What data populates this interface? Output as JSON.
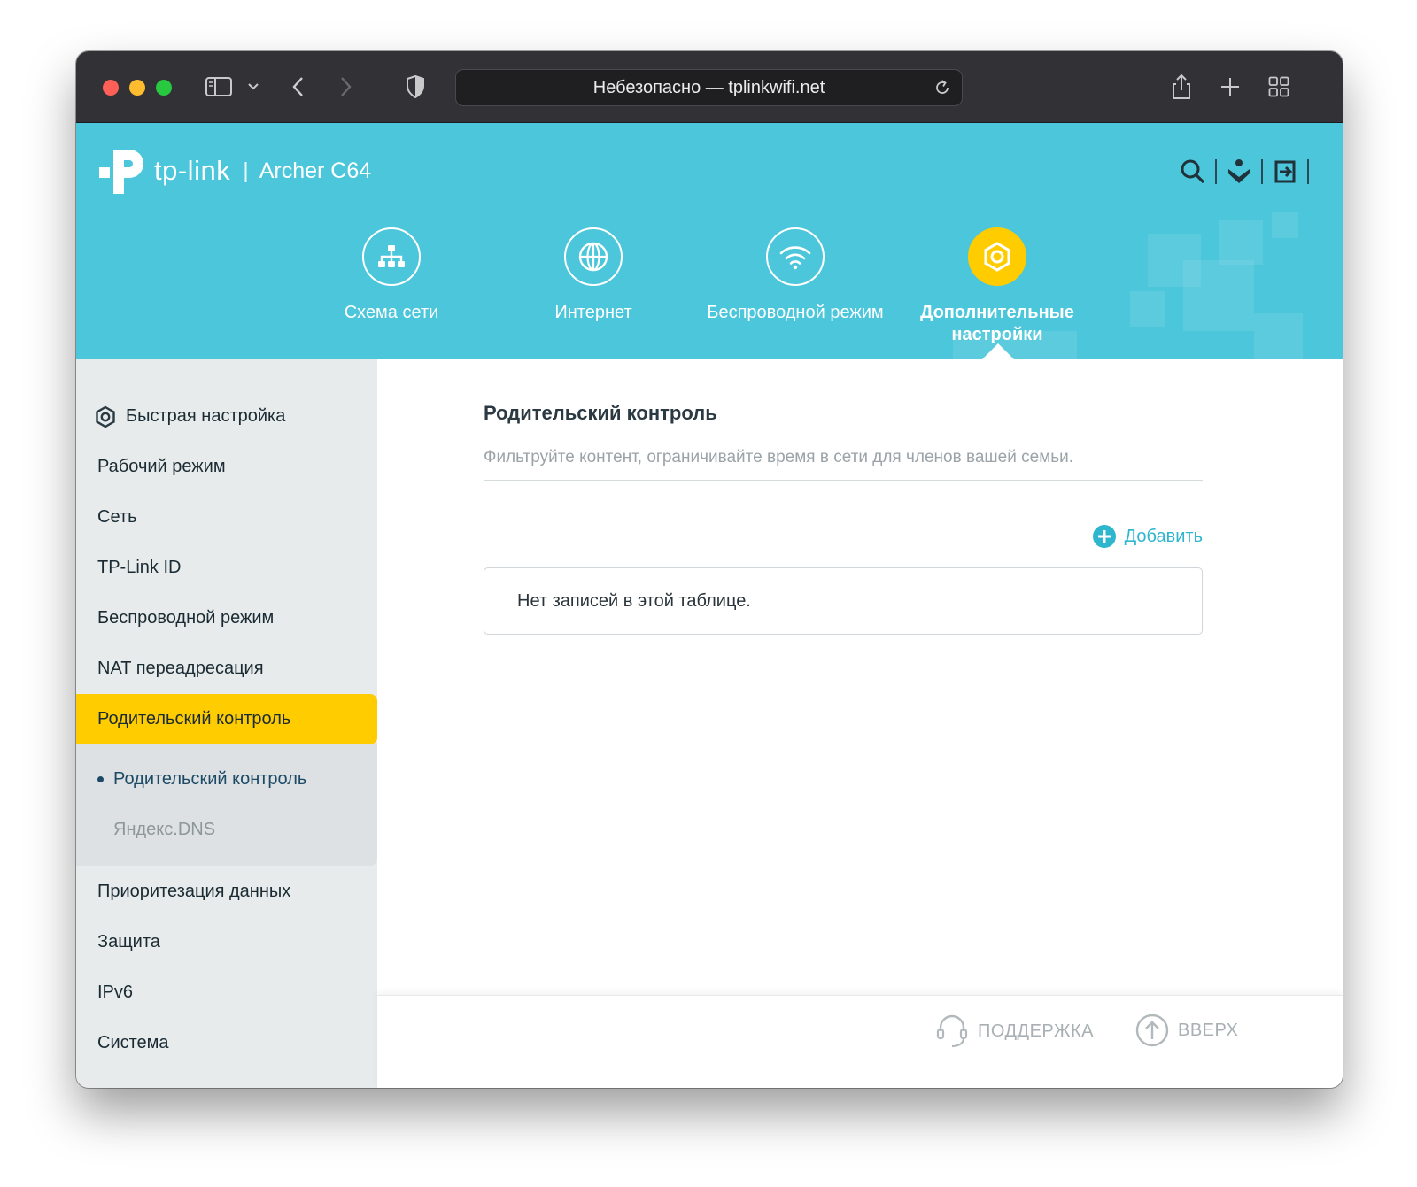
{
  "browser": {
    "address": "Небезопасно — tplinkwifi.net"
  },
  "header": {
    "brand": "tp-link",
    "separator": "|",
    "model": "Archer C64",
    "nav": [
      {
        "label": "Схема сети"
      },
      {
        "label": "Интернет"
      },
      {
        "label": "Беспроводной режим"
      },
      {
        "label": "Дополнительные настройки"
      }
    ]
  },
  "sidebar": {
    "items": [
      {
        "label": "Быстрая настройка"
      },
      {
        "label": "Рабочий режим"
      },
      {
        "label": "Сеть"
      },
      {
        "label": "TP-Link ID"
      },
      {
        "label": "Беспроводной режим"
      },
      {
        "label": "NAT переадресация"
      },
      {
        "label": "Родительский контроль"
      },
      {
        "label": "Приоритезация данных"
      },
      {
        "label": "Защита"
      },
      {
        "label": "IPv6"
      },
      {
        "label": "Система"
      }
    ],
    "subitems": [
      {
        "label": "Родительский контроль"
      },
      {
        "label": "Яндекс.DNS"
      }
    ]
  },
  "main": {
    "title": "Родительский контроль",
    "description": "Фильтруйте контент, ограничивайте время в сети для членов вашей семьи.",
    "add_label": "Добавить",
    "empty_text": "Нет записей в этой таблице."
  },
  "footer": {
    "support_label": "ПОДДЕРЖКА",
    "top_label": "ВВЕРХ"
  },
  "colors": {
    "header_bg": "#4bc6da",
    "accent_yellow": "#ffcc00",
    "link_teal": "#2fb6cf"
  }
}
